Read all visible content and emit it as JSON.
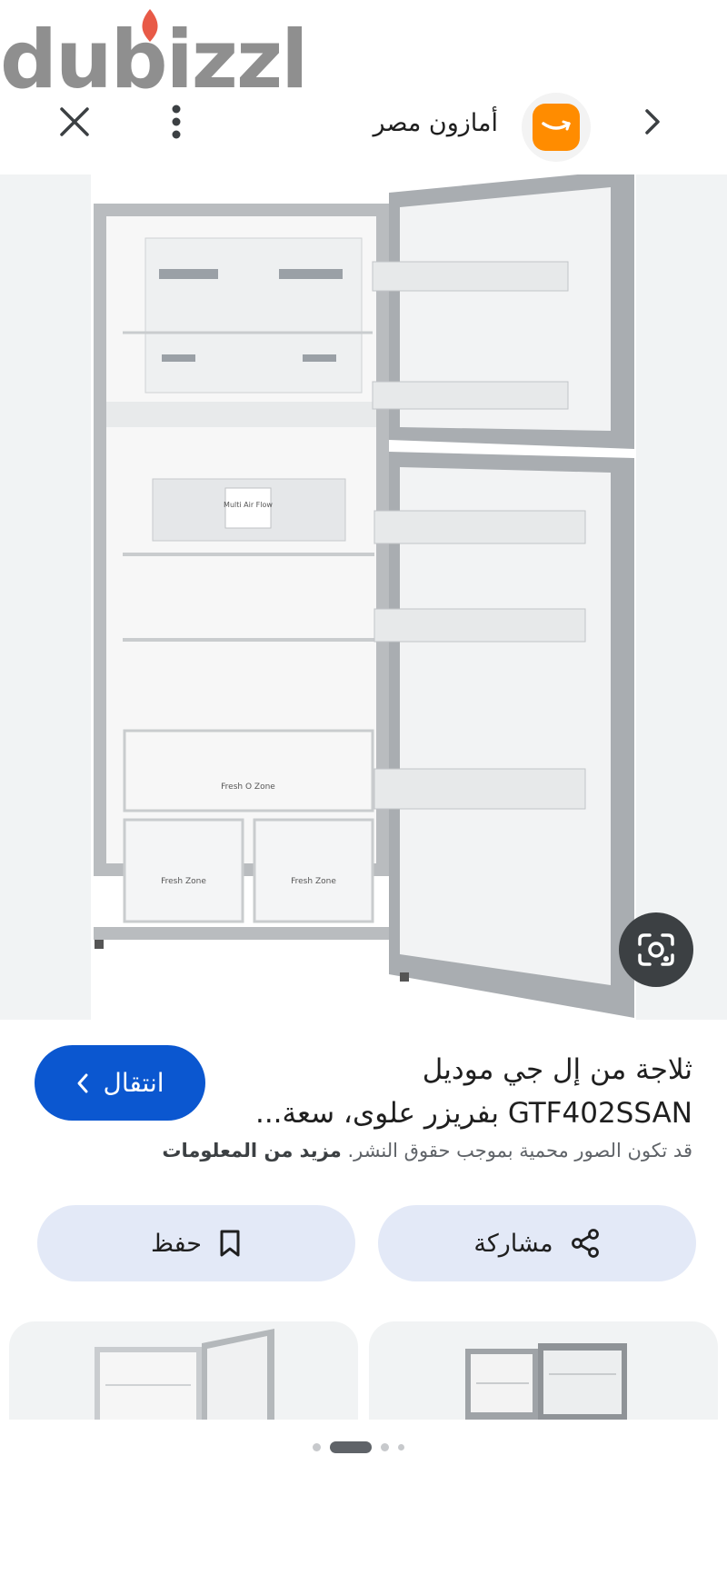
{
  "watermark": {
    "text": "dubizzle"
  },
  "topbar": {
    "site_name": "أمازون مصر",
    "icons": {
      "back": "chevron-right-icon",
      "menu": "more-vert-icon",
      "close": "close-icon",
      "site": "amazon-smile-logo"
    }
  },
  "result": {
    "title_line1": "ثلاجة من إل جي موديل",
    "title_line2": "GTF402SSAN بفريزر علوى، سعة...",
    "visit_label": "انتقال",
    "copyright_text": "قد تكون الصور محمية بموجب حقوق النشر.",
    "more_info": "مزيد من المعلومات"
  },
  "fridge_labels": {
    "multi_air_flow": "Multi Air Flow",
    "fresh_o_zone": "Fresh O Zone",
    "fresh_zone": "Fresh Zone"
  },
  "actions": {
    "share_label": "مشاركة",
    "save_label": "حفظ"
  },
  "colors": {
    "accent": "#0b57d0",
    "amazon_orange": "#ff8c00",
    "action_bg": "#e3e9f7"
  }
}
